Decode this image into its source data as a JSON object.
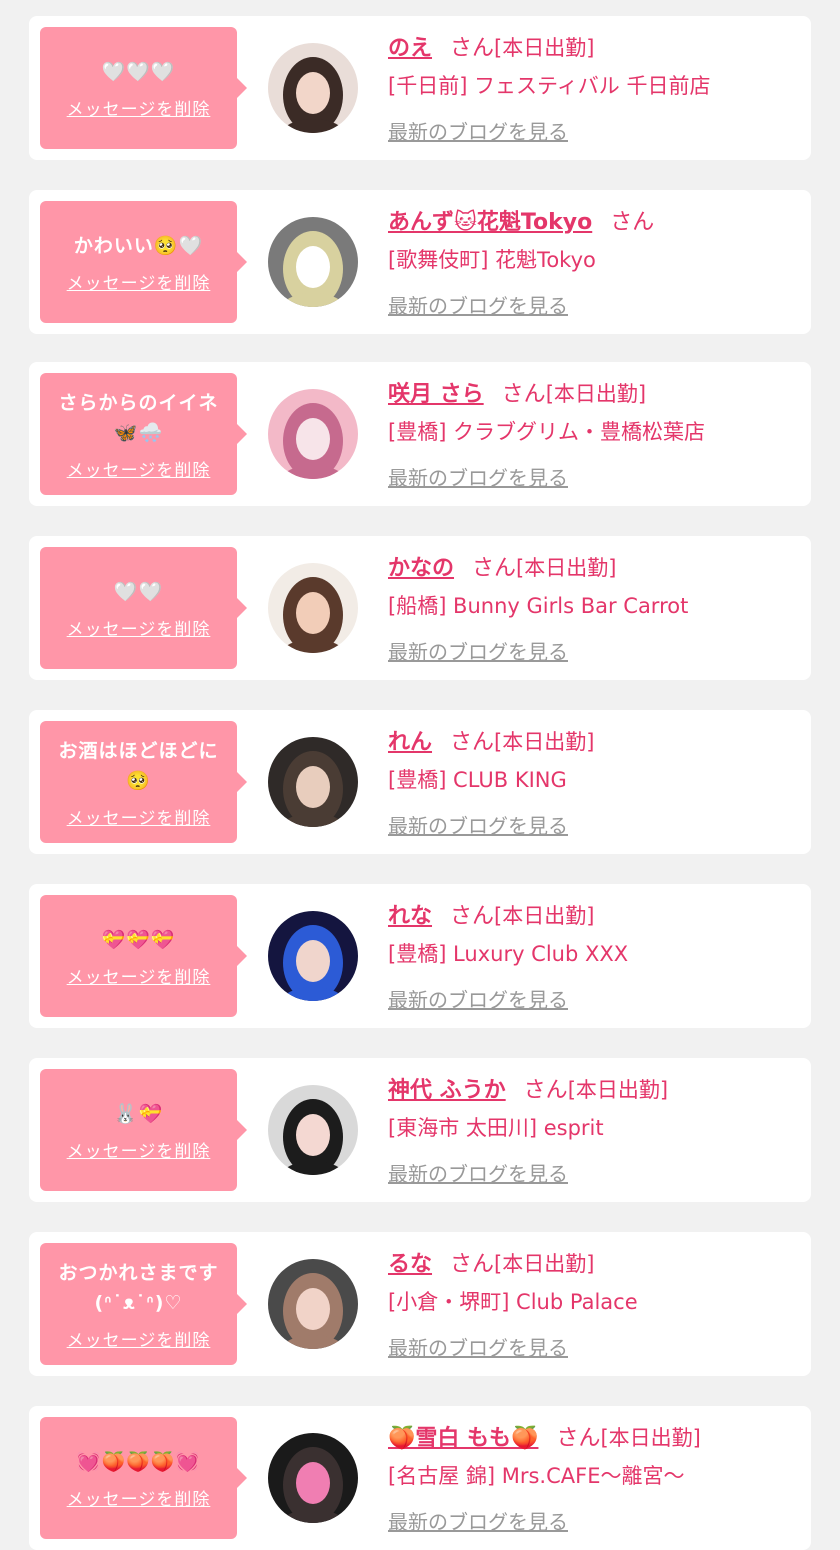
{
  "common": {
    "delete_label": "メッセージを削除",
    "blog_label": "最新のブログを見る",
    "san_label": "さん"
  },
  "messages": [
    {
      "message": "🤍🤍🤍",
      "name": "のえ",
      "status": "[本日出勤]",
      "shop": "[千日前] フェスティバル 千日前店"
    },
    {
      "message": "かわいい🥺🤍",
      "name": "あんず🐱花魁Tokyo",
      "status": "",
      "shop": "[歌舞伎町] 花魁Tokyo"
    },
    {
      "message": "さらからのイイネ\n🦋🌨️",
      "name": "咲月 さら",
      "status": "[本日出勤]",
      "shop": "[豊橋] クラブグリム・豊橋松葉店"
    },
    {
      "message": "🤍🤍",
      "name": "かなの",
      "status": "[本日出勤]",
      "shop": "[船橋] Bunny Girls Bar Carrot"
    },
    {
      "message": "お酒はほどほどに\n🥺",
      "name": "れん",
      "status": "[本日出勤]",
      "shop": "[豊橋] CLUB KING"
    },
    {
      "message": "💝💝💝",
      "name": "れな",
      "status": "[本日出勤]",
      "shop": "[豊橋] Luxury Club XXX"
    },
    {
      "message": "🐰💝",
      "name": "神代 ふうか",
      "status": "[本日出勤]",
      "shop": "[東海市 太田川] esprit"
    },
    {
      "message": "おつかれさまです\n(ᐢ˙ᴥ˙ᐢ)♡",
      "name": "るな",
      "status": "[本日出勤]",
      "shop": "[小倉・堺町] Club Palace"
    },
    {
      "message": "💓🍑🍑🍑💓",
      "name": "🍑雪白 もも🍑",
      "status": "[本日出勤]",
      "shop": "[名古屋 錦] Mrs.CAFE〜離宮〜"
    }
  ]
}
